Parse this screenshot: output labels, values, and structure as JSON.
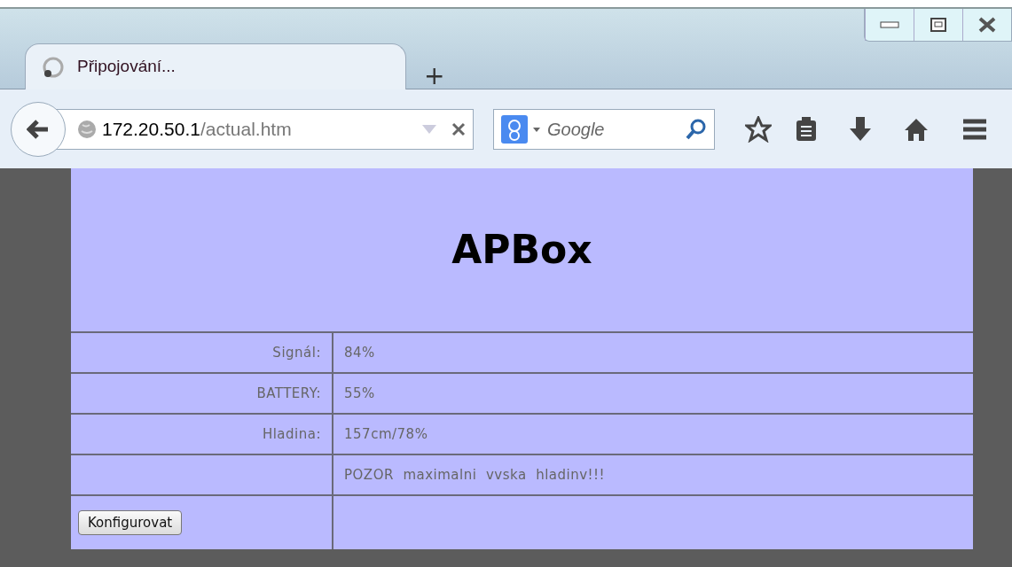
{
  "browser": {
    "tab": {
      "title": "Připojování...",
      "selected": true
    },
    "new_tab": "+",
    "address": {
      "host": "172.20.50.1",
      "path": "/actual.htm"
    },
    "search": {
      "placeholder": "Google"
    }
  },
  "page": {
    "heading": "APBox",
    "rows": [
      {
        "label": "Signál:",
        "value": "84%"
      },
      {
        "label": "BATTERY:",
        "value": "55%"
      },
      {
        "label": "Hladina:",
        "value": "157cm/78%"
      },
      {
        "value": "POZOR  maximalni  vvska  hladinv!!!"
      }
    ],
    "button": "Konfigurovat"
  }
}
